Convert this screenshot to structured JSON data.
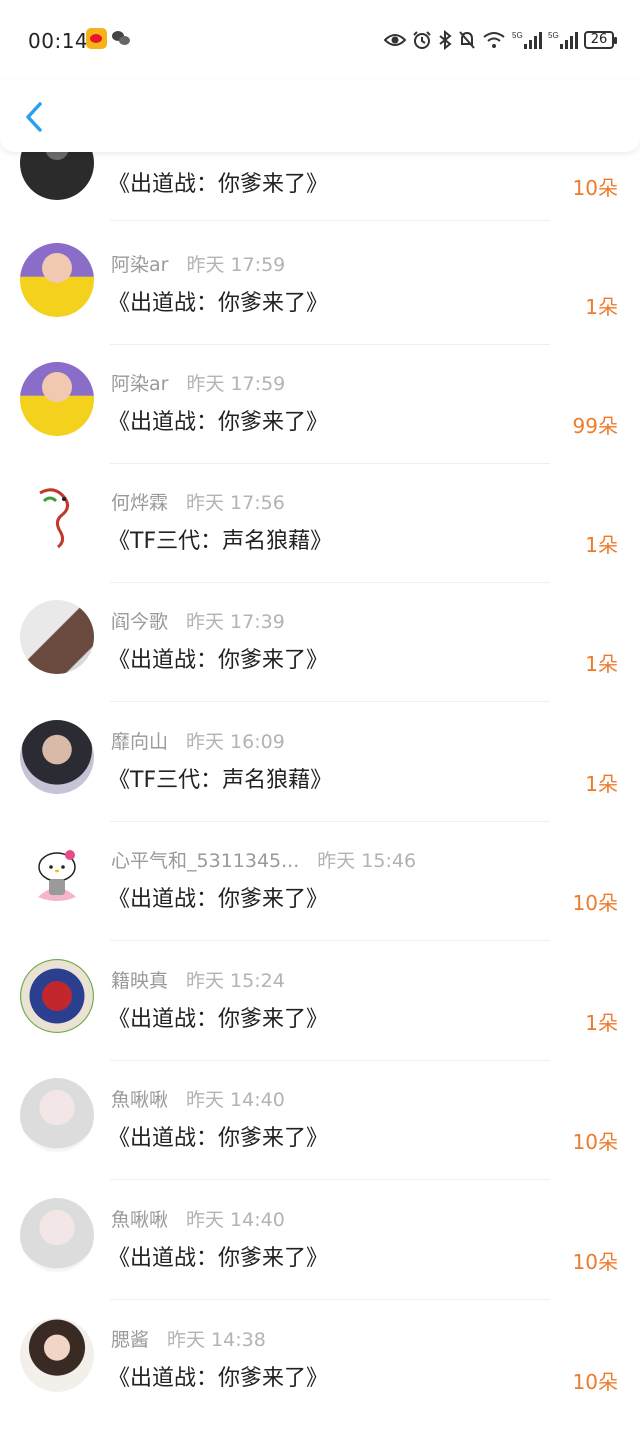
{
  "status_bar": {
    "time": "00:14",
    "battery": "26",
    "network": [
      "5G",
      "5G"
    ],
    "icons": [
      "weibo-icon",
      "wechat-icon",
      "eye-icon",
      "alarm-icon",
      "bluetooth-icon",
      "mute-icon",
      "wifi-icon",
      "signal-icon",
      "signal-icon",
      "battery-icon"
    ]
  },
  "nav": {
    "back_icon": "chevron-left-icon",
    "accent": "#2a9ff0"
  },
  "colors": {
    "flower": "#ee7b2a",
    "meta": "#9a9a9a",
    "text": "#222222"
  },
  "items": [
    {
      "name": "",
      "time": "",
      "work": "《出道战：你爹来了》",
      "flowers": "10朵"
    },
    {
      "name": "阿染ar",
      "time": "昨天 17:59",
      "work": "《出道战：你爹来了》",
      "flowers": "1朵"
    },
    {
      "name": "阿染ar",
      "time": "昨天 17:59",
      "work": "《出道战：你爹来了》",
      "flowers": "99朵"
    },
    {
      "name": "何烨霖",
      "time": "昨天 17:56",
      "work": "《TF三代：声名狼藉》",
      "flowers": "1朵"
    },
    {
      "name": "阎今歌",
      "time": "昨天 17:39",
      "work": "《出道战：你爹来了》",
      "flowers": "1朵"
    },
    {
      "name": "靡向山",
      "time": "昨天 16:09",
      "work": "《TF三代：声名狼藉》",
      "flowers": "1朵"
    },
    {
      "name": "心平气和_5311345...",
      "time": "昨天 15:46",
      "work": "《出道战：你爹来了》",
      "flowers": "10朵"
    },
    {
      "name": "籍映真",
      "time": "昨天 15:24",
      "work": "《出道战：你爹来了》",
      "flowers": "1朵"
    },
    {
      "name": "魚啾啾",
      "time": "昨天 14:40",
      "work": "《出道战：你爹来了》",
      "flowers": "10朵"
    },
    {
      "name": "魚啾啾",
      "time": "昨天 14:40",
      "work": "《出道战：你爹来了》",
      "flowers": "10朵"
    },
    {
      "name": "腮酱",
      "time": "昨天 14:38",
      "work": "《出道战：你爹来了》",
      "flowers": "10朵"
    }
  ]
}
